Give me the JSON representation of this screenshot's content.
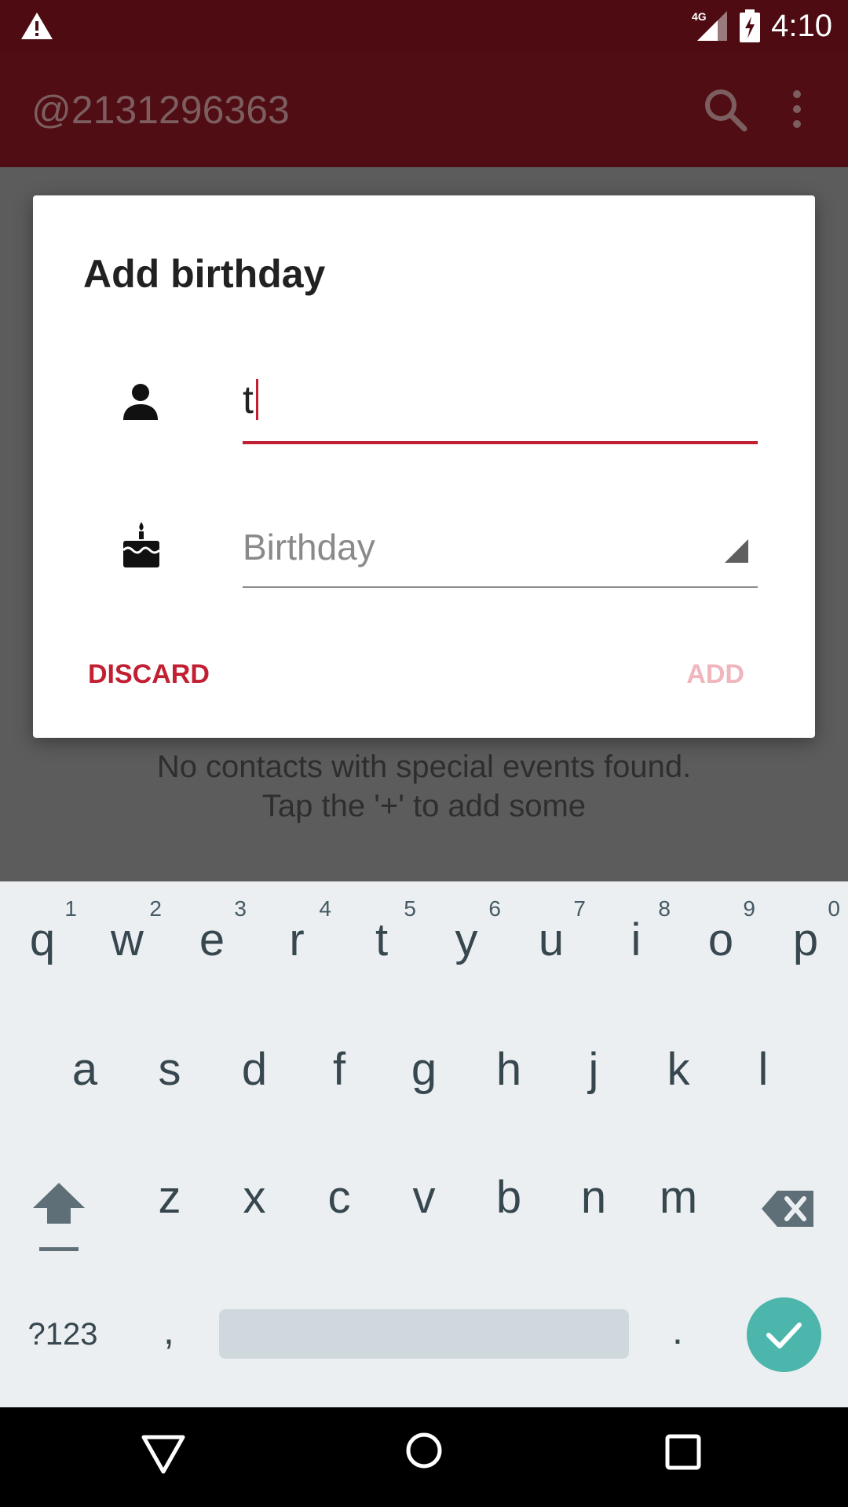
{
  "status_bar": {
    "time": "4:10",
    "network": "4G"
  },
  "app_bar": {
    "title": "@2131296363"
  },
  "dialog": {
    "title": "Add birthday",
    "name_value": "t",
    "birthday_placeholder": "Birthday",
    "discard_label": "DISCARD",
    "add_label": "ADD"
  },
  "empty_state": {
    "line1": "No contacts with special events found.",
    "line2": "Tap the '+' to add some"
  },
  "keyboard": {
    "row1": [
      {
        "key": "q",
        "hint": "1"
      },
      {
        "key": "w",
        "hint": "2"
      },
      {
        "key": "e",
        "hint": "3"
      },
      {
        "key": "r",
        "hint": "4"
      },
      {
        "key": "t",
        "hint": "5"
      },
      {
        "key": "y",
        "hint": "6"
      },
      {
        "key": "u",
        "hint": "7"
      },
      {
        "key": "i",
        "hint": "8"
      },
      {
        "key": "o",
        "hint": "9"
      },
      {
        "key": "p",
        "hint": "0"
      }
    ],
    "row2": [
      "a",
      "s",
      "d",
      "f",
      "g",
      "h",
      "j",
      "k",
      "l"
    ],
    "row3": [
      "z",
      "x",
      "c",
      "v",
      "b",
      "n",
      "m"
    ],
    "symbols_label": "?123",
    "comma": ",",
    "period": "."
  },
  "colors": {
    "status_bar": "#4e0c12",
    "app_bar": "#500d13",
    "accent": "#c21f32",
    "add_disabled": "#f0b5bd",
    "enter_key": "#4db6ac",
    "keyboard_bg": "#eceff1"
  }
}
